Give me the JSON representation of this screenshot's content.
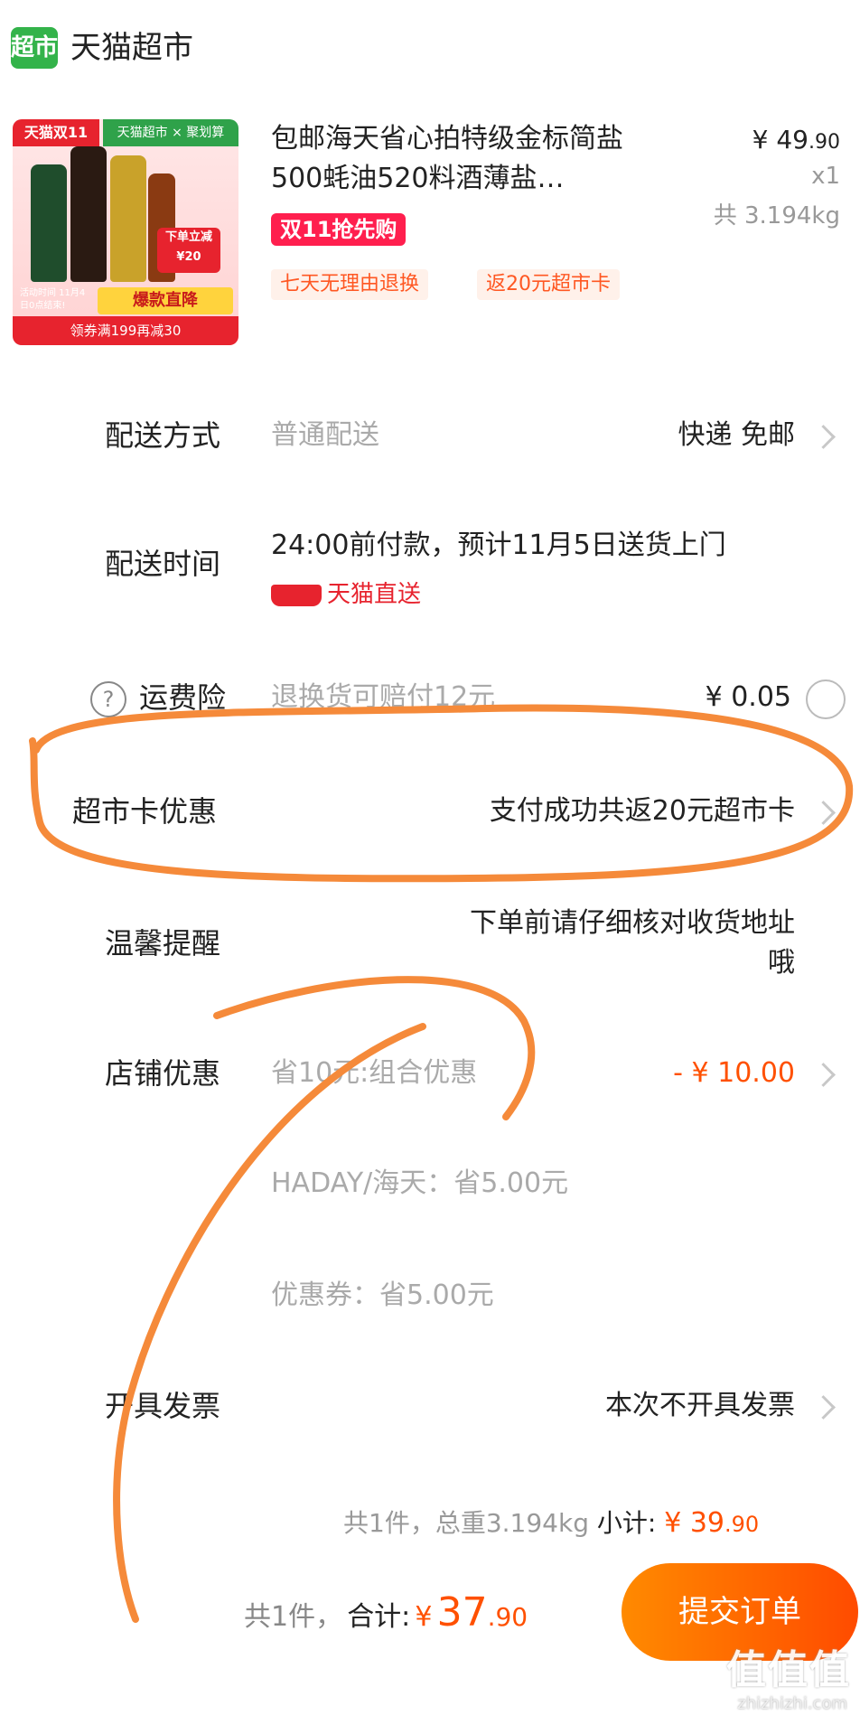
{
  "header": {
    "logo_text": "超市",
    "store_name": "天猫超市"
  },
  "product": {
    "image_tags": {
      "red_tag": "天猫双11",
      "green_tag": "天猫超市 × 聚划算",
      "badge": "下单立减 ¥20",
      "bar1": "爆款直降",
      "bar2": "领券满199再减30",
      "side": "活动时间 11月4日0点结束!"
    },
    "title": "包邮海天省心拍特级金标简盐500蚝油520料酒薄盐…",
    "price_int": "¥ 49",
    "price_dec": ".90",
    "qty": "x1",
    "weight": "共 3.194kg",
    "promo_tag": "双11抢先购",
    "service_tags": [
      "七天无理由退换",
      "返20元超市卡"
    ]
  },
  "rows": {
    "delivery_method": {
      "label": "配送方式",
      "sub": "普通配送",
      "value": "快递 免邮"
    },
    "delivery_time": {
      "label": "配送时间",
      "value": "24:00前付款，预计11月5日送货上门",
      "brand": "天猫直送"
    },
    "shipping_insurance": {
      "help_icon": "?",
      "label": "运费险",
      "sub": "退换货可赔付12元",
      "value": "¥ 0.05"
    },
    "market_card": {
      "label": "超市卡优惠",
      "value": "支付成功共返20元超市卡"
    },
    "reminder": {
      "label": "温馨提醒",
      "value_line1": "下单前请仔细核对收货地址",
      "value_line2": "哦"
    },
    "store_discount": {
      "label": "店铺优惠",
      "sub": "省10元:组合优惠",
      "value": "- ¥ 10.00",
      "detail1": "HADAY/海天：省5.00元",
      "detail2": "优惠券：省5.00元"
    },
    "invoice": {
      "label": "开具发票",
      "value": "本次不开具发票"
    }
  },
  "summary": {
    "text": "共1件，总重3.194kg",
    "subtotal_label": "小计:",
    "subtotal_int": "¥ 39",
    "subtotal_dec": ".90"
  },
  "footer": {
    "count": "共1件，",
    "total_label": "合计:",
    "total_currency": "¥",
    "total_int": "37",
    "total_dec": ".90",
    "submit": "提交订单"
  },
  "watermark": {
    "main": "值值值",
    "sub": "zhizhizhi.com"
  },
  "colors": {
    "accent": "#ff5000",
    "brand_green": "#33b34a",
    "annotation": "#f58a3a"
  }
}
